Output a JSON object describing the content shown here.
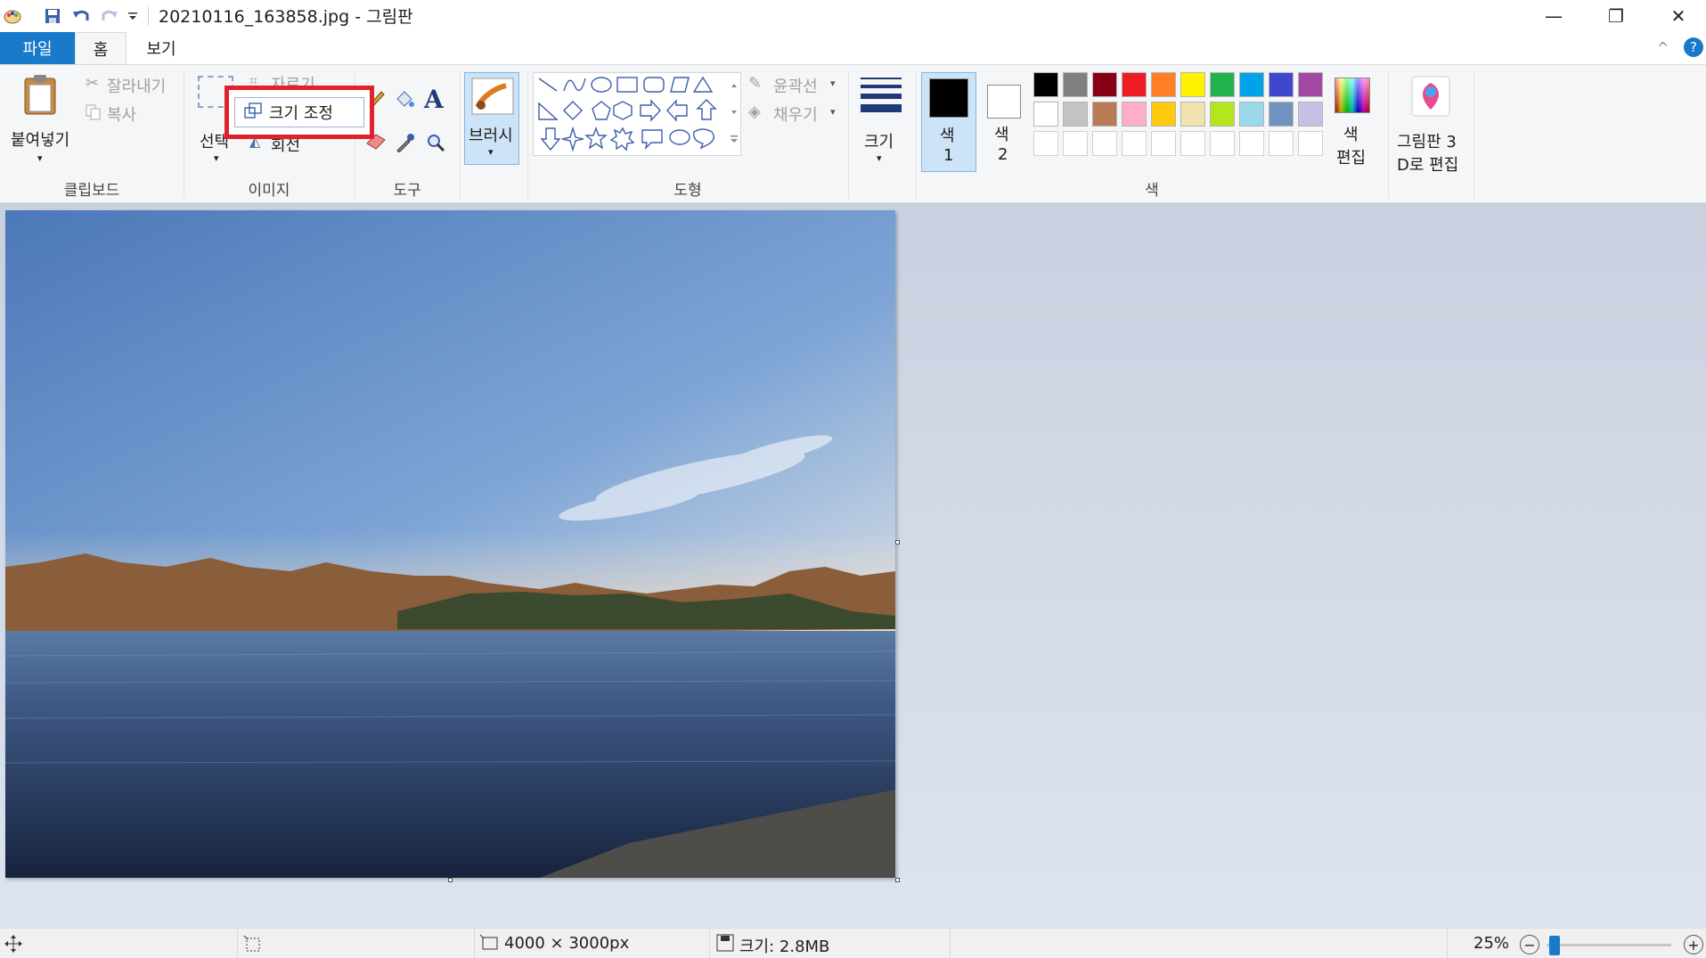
{
  "window": {
    "title": "20210116_163858.jpg - 그림판",
    "minimize_glyph": "—",
    "restore_glyph": "❐",
    "close_glyph": "✕"
  },
  "quick_access": {
    "icons": [
      "paint-app-icon",
      "save-icon",
      "undo-icon",
      "redo-icon",
      "customize-dropdown-icon"
    ]
  },
  "tabs": [
    {
      "label": "파일"
    },
    {
      "label": "홈"
    },
    {
      "label": "보기"
    }
  ],
  "ribbon": {
    "collapse_glyph": "^",
    "help_glyph": "?",
    "clipboard": {
      "label": "클립보드",
      "paste_label": "붙여넣기",
      "cut_label": "잘라내기",
      "copy_label": "복사"
    },
    "image": {
      "label": "이미지",
      "select_label": "선택",
      "crop_label": "자르기",
      "resize_label": "크기 조정",
      "rotate_label": "회전"
    },
    "tools": {
      "label": "도구",
      "text_glyph": "A"
    },
    "brush": {
      "label": "브러시"
    },
    "shapes": {
      "label": "도형",
      "outline_label": "윤곽선",
      "fill_label": "채우기"
    },
    "size": {
      "label": "크기"
    },
    "colors": {
      "label": "색",
      "color1_label": "색",
      "color1_num": "1",
      "color2_label": "색",
      "color2_num": "2",
      "edit_colors_line1": "색",
      "edit_colors_line2": "편집",
      "paint3d_line1": "그림판 3",
      "paint3d_line2": "D로 편집",
      "color1_value": "#000000",
      "color2_value": "#ffffff",
      "palette_row1": [
        "#000000",
        "#7f7f7f",
        "#880015",
        "#ed1c24",
        "#ff7f27",
        "#fff200",
        "#22b14c",
        "#00a2e8",
        "#3f48cc",
        "#a349a4"
      ],
      "palette_row2": [
        "#ffffff",
        "#c3c3c3",
        "#b97a57",
        "#ffaec9",
        "#ffc90e",
        "#efe4b0",
        "#b5e61d",
        "#99d9ea",
        "#7092be",
        "#c8bfe7"
      ],
      "palette_row3": [
        "#ffffff",
        "#ffffff",
        "#ffffff",
        "#ffffff",
        "#ffffff",
        "#ffffff",
        "#ffffff",
        "#ffffff",
        "#ffffff",
        "#ffffff"
      ]
    }
  },
  "statusbar": {
    "dimensions": "4000 × 3000px",
    "file_size": "크기: 2.8MB",
    "zoom": "25%",
    "zoom_level_percent": 25,
    "zoom_out_glyph": "−",
    "zoom_in_glyph": "+"
  }
}
